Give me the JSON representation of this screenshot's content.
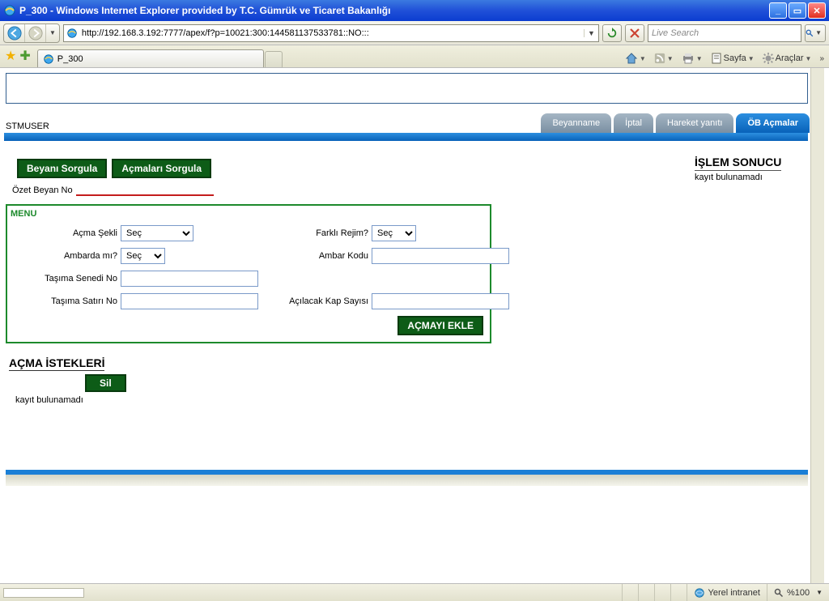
{
  "window": {
    "title": "P_300 - Windows Internet Explorer provided by T.C. Gümrük ve Ticaret Bakanlığı"
  },
  "address": {
    "url": "http://192.168.3.192:7777/apex/f?p=10021:300:144581137533781::NO:::"
  },
  "search": {
    "placeholder": "Live Search"
  },
  "browsertab": {
    "label": "P_300"
  },
  "toolbar": {
    "sayfa": "Sayfa",
    "araclar": "Araçlar"
  },
  "user": "STMUSER",
  "apptabs": {
    "beyanname": "Beyanname",
    "iptal": "İptal",
    "hareket": "Hareket yanıtı",
    "ob": "ÖB Açmalar"
  },
  "result": {
    "title": "İŞLEM SONUCU",
    "none": "kayıt bulunamadı"
  },
  "buttons": {
    "beyani": "Beyanı Sorgula",
    "acmalari": "Açmaları Sorgula",
    "acmayi_ekle": "AÇMAYI EKLE",
    "sil": "Sil"
  },
  "labels": {
    "ozet_beyan_no": "Özet Beyan No",
    "menu": "MENU",
    "acma_sekli": "Açma Şekli",
    "ambarda_mi": "Ambarda mı?",
    "tasima_senedi_no": "Taşıma Senedi No",
    "tasima_satiri_no": "Taşıma Satırı No",
    "farkli_rejim": "Farklı Rejim?",
    "ambar_kodu": "Ambar Kodu",
    "acilacak_kap": "Açılacak Kap Sayısı",
    "acma_istekleri": "AÇMA İSTEKLERİ",
    "kayit_bulunamadi": "kayıt bulunamadı"
  },
  "selects": {
    "sec": "Seç"
  },
  "status": {
    "zone": "Yerel intranet",
    "zoom": "%100"
  }
}
